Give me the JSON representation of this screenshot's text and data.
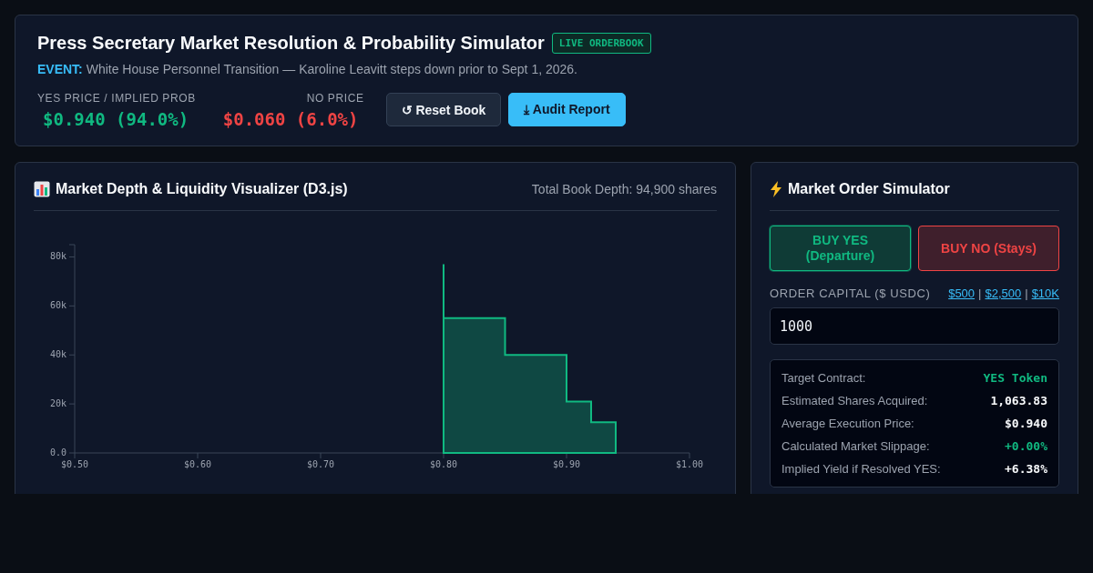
{
  "header": {
    "title": "Press Secretary Market Resolution & Probability Simulator",
    "badge": "LIVE ORDERBOOK",
    "event": {
      "label": "EVENT:",
      "text": "White House Personnel Transition — Karoline Leavitt steps down prior to Sept 1, 2026."
    },
    "stats": [
      {
        "label": "YES PRICE / IMPLIED PROB",
        "value": "$0.940 (94.0%)",
        "kind": "yes"
      },
      {
        "label": "NO PRICE",
        "value": "$0.060 (6.0%)",
        "kind": "no"
      }
    ],
    "buttons": [
      {
        "label": "↺ Reset Book",
        "kind": "secondary"
      },
      {
        "label": "⤓ Audit Report",
        "kind": "primary"
      }
    ]
  },
  "depth": {
    "title": "Market Depth & Liquidity Visualizer (D3.js)",
    "total": "Total Book Depth: 94,900 shares",
    "chart_data": {
      "type": "area",
      "x": [
        0.8,
        0.8,
        0.85,
        0.9,
        0.92,
        0.94
      ],
      "series": [
        {
          "color": "#10b981",
          "values": [
            77000,
            55000,
            40000,
            21000,
            12500,
            0
          ]
        }
      ],
      "xlim": [
        0.5,
        1.0
      ],
      "ylim": [
        0,
        85000
      ],
      "xticks": [
        {
          "value": 0.5,
          "label": "$0.50"
        },
        {
          "value": 0.6,
          "label": "$0.60"
        },
        {
          "value": 0.7,
          "label": "$0.70"
        },
        {
          "value": 0.8,
          "label": "$0.80"
        },
        {
          "value": 0.9,
          "label": "$0.90"
        },
        {
          "value": 1.0,
          "label": "$1.00"
        }
      ],
      "yticks": [
        {
          "value": 0,
          "label": "0.0"
        },
        {
          "value": 20000,
          "label": "20k"
        },
        {
          "value": 40000,
          "label": "40k"
        },
        {
          "value": 60000,
          "label": "60k"
        },
        {
          "value": 80000,
          "label": "80k"
        }
      ]
    }
  },
  "simulator": {
    "title": "Market Order Simulator",
    "sides": [
      {
        "label": "BUY YES (Departure)",
        "kind": "yes",
        "selected": true
      },
      {
        "label": "BUY NO (Stays)",
        "kind": "no",
        "selected": false
      }
    ],
    "capital_label": "ORDER CAPITAL ($ USDC)",
    "presets": [
      "$500",
      "$2,500",
      "$10K"
    ],
    "preset_separator": "|",
    "capital_value": "1000",
    "results": [
      {
        "label": "Target Contract:",
        "value": "YES Token",
        "kind": "accent"
      },
      {
        "label": "Estimated Shares Acquired:",
        "value": "1,063.83",
        "kind": "plain"
      },
      {
        "label": "Average Execution Price:",
        "value": "$0.940",
        "kind": "plain"
      },
      {
        "label": "Calculated Market Slippage:",
        "value": "+0.00%",
        "kind": "accent"
      },
      {
        "label": "Implied Yield if Resolved YES:",
        "value": "+6.38%",
        "kind": "plain"
      }
    ]
  }
}
